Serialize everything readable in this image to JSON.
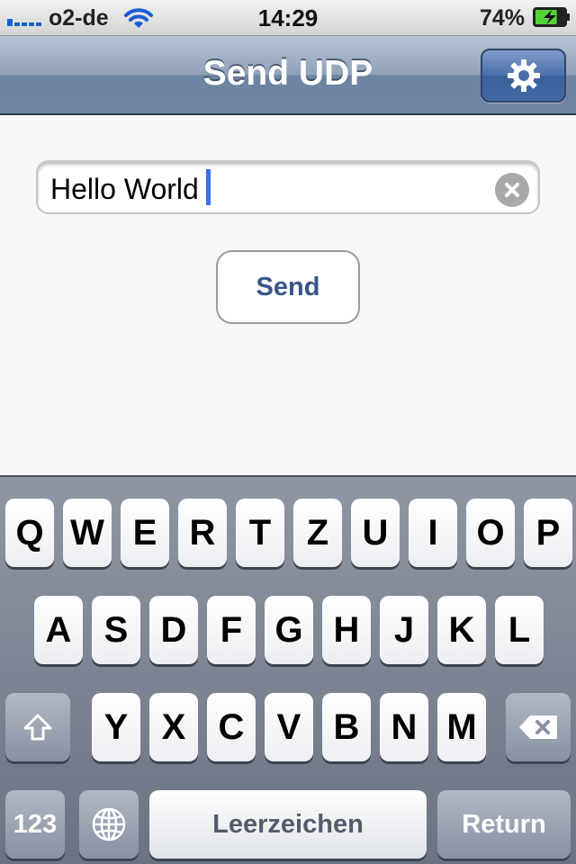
{
  "status_bar": {
    "carrier": "o2-de",
    "time": "14:29",
    "battery_percent": "74%",
    "battery_level": 0.74,
    "icons": [
      "signal-icon",
      "wifi-icon",
      "battery-charging-icon"
    ]
  },
  "nav_bar": {
    "title": "Send UDP",
    "settings_icon": "gear-icon"
  },
  "form": {
    "message_value": "Hello World",
    "clear_icon": "clear-icon",
    "send_label": "Send"
  },
  "keyboard": {
    "row1": [
      "Q",
      "W",
      "E",
      "R",
      "T",
      "Z",
      "U",
      "I",
      "O",
      "P"
    ],
    "row2": [
      "A",
      "S",
      "D",
      "F",
      "G",
      "H",
      "J",
      "K",
      "L"
    ],
    "row3": [
      "Y",
      "X",
      "C",
      "V",
      "B",
      "N",
      "M"
    ],
    "numbers_label": "123",
    "space_label": "Leerzeichen",
    "return_label": "Return",
    "icons": [
      "shift-icon",
      "backspace-icon",
      "globe-icon"
    ]
  },
  "colors": {
    "accent_blue": "#385487",
    "nav_bar": "#6d84a2",
    "cursor": "#3b6ff0"
  }
}
